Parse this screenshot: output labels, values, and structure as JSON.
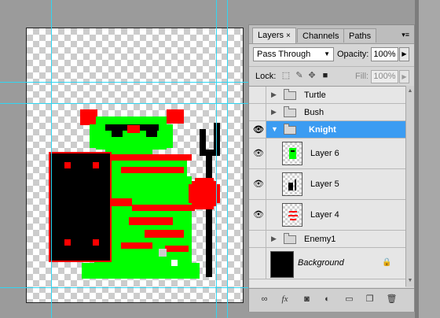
{
  "tabs": [
    {
      "label": "Layers",
      "active": true
    },
    {
      "label": "Channels",
      "active": false
    },
    {
      "label": "Paths",
      "active": false
    }
  ],
  "tab_close": "×",
  "panel_menu_icon": "panel-menu-icon",
  "blend_mode": "Pass Through",
  "opacity_label": "Opacity:",
  "opacity_value": "100%",
  "lock_label": "Lock:",
  "fill_label": "Fill:",
  "fill_value": "100%",
  "layers": [
    {
      "name": "Turtle",
      "type": "group",
      "visible": false,
      "expanded": false,
      "selected": false
    },
    {
      "name": "Bush",
      "type": "group",
      "visible": false,
      "expanded": false,
      "selected": false
    },
    {
      "name": "Knight",
      "type": "group",
      "visible": true,
      "expanded": true,
      "selected": true
    },
    {
      "name": "Layer 6",
      "type": "layer",
      "visible": true,
      "selected": false
    },
    {
      "name": "Layer 5",
      "type": "layer",
      "visible": true,
      "selected": false
    },
    {
      "name": "Layer 4",
      "type": "layer",
      "visible": true,
      "selected": false
    },
    {
      "name": "Enemy1",
      "type": "group",
      "visible": false,
      "expanded": false,
      "selected": false
    },
    {
      "name": "Background",
      "type": "background",
      "visible": false,
      "locked": true,
      "selected": false
    }
  ],
  "bottom_icons": [
    "link-layers-icon",
    "fx-icon",
    "add-mask-icon",
    "adjustment-layer-icon",
    "new-group-icon",
    "new-layer-icon",
    "delete-layer-icon"
  ],
  "colors": {
    "selection": "#3b9cf2",
    "guide": "#31d6f2",
    "knight_green": "#00ff00",
    "knight_red": "#ff0000",
    "knight_black": "#000000"
  }
}
